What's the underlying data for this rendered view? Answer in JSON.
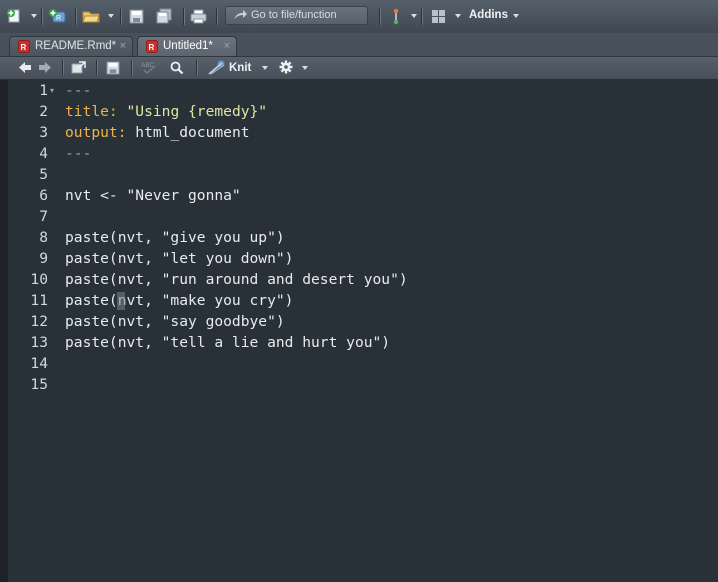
{
  "toolbar": {
    "goto_placeholder": "Go to file/function",
    "addins_label": "Addins"
  },
  "tabs": [
    {
      "label": "README.Rmd*",
      "close": "×",
      "active": false
    },
    {
      "label": "Untitled1*",
      "close": "×",
      "active": true
    }
  ],
  "editor_toolbar": {
    "knit_label": "Knit"
  },
  "editor": {
    "line_numbers": [
      "1",
      "2",
      "3",
      "4",
      "5",
      "6",
      "7",
      "8",
      "9",
      "10",
      "11",
      "12",
      "13",
      "14",
      "15"
    ],
    "lines": [
      [
        {
          "t": "---",
          "c": "dash"
        }
      ],
      [
        {
          "t": "title:",
          "c": "key"
        },
        {
          "t": " ",
          "c": "plain"
        },
        {
          "t": "\"Using {remedy}\"",
          "c": "str"
        }
      ],
      [
        {
          "t": "output:",
          "c": "key"
        },
        {
          "t": " html_document",
          "c": "plain"
        }
      ],
      [
        {
          "t": "---",
          "c": "dash"
        }
      ],
      [],
      [
        {
          "t": "nvt <- \"Never gonna\"",
          "c": "plain"
        }
      ],
      [],
      [
        {
          "t": "paste(nvt, \"give you up\")",
          "c": "plain"
        }
      ],
      [
        {
          "t": "paste(nvt, \"let you down\")",
          "c": "plain"
        }
      ],
      [
        {
          "t": "paste(nvt, \"run around and desert you\")",
          "c": "plain"
        }
      ],
      [
        {
          "t": "paste(nvt, \"make you cry\")",
          "c": "plain"
        }
      ],
      [
        {
          "t": "paste(nvt, \"say goodbye\")",
          "c": "plain"
        }
      ],
      [
        {
          "t": "paste(nvt, \"tell a lie and hurt you\")",
          "c": "plain"
        }
      ],
      [],
      []
    ],
    "fold_line": 1,
    "cursor": {
      "line": 11,
      "column": 6
    }
  },
  "colors": {
    "editor_background": "#293138",
    "yaml_key": "#eeb34f",
    "string": "#dfe6a3",
    "plain_text": "#e8eaed"
  },
  "icons": [
    "new-file-icon",
    "new-project-icon",
    "open-folder-icon",
    "save-icon",
    "save-all-icon",
    "print-icon",
    "goto-arrow-icon",
    "version-control-icon",
    "grid-layout-icon",
    "nav-back-icon",
    "nav-forward-icon",
    "show-in-window-icon",
    "spell-check-icon",
    "search-icon",
    "knit-icon",
    "gear-icon",
    "rmd-document-icon",
    "close-icon"
  ]
}
